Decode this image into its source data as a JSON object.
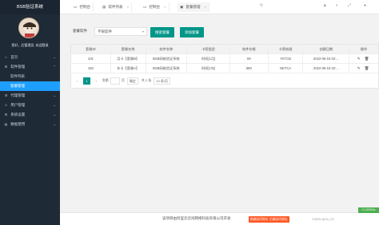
{
  "app": {
    "title": "BSB验证系统"
  },
  "user": {
    "greeting": "您好，后管理员, 欢迎登录"
  },
  "sidebar": {
    "items": [
      {
        "icon": "home-icon",
        "label": "首页",
        "arrow": "⌄"
      },
      {
        "icon": "software-icon",
        "label": "软件管理",
        "arrow": "⌃"
      },
      {
        "icon": "agent-icon",
        "label": "代理管理",
        "arrow": "⌄"
      },
      {
        "icon": "user-icon",
        "label": "用户管理",
        "arrow": "⌄"
      },
      {
        "icon": "settings-icon",
        "label": "系统设置",
        "arrow": "⌄"
      },
      {
        "icon": "report-icon",
        "label": "数据使用",
        "arrow": "⌄"
      }
    ],
    "subitems": [
      {
        "label": "软件列表"
      },
      {
        "label": "套餐管理"
      }
    ]
  },
  "header": {
    "home": "控制台",
    "tabs": [
      {
        "label": "控制台"
      },
      {
        "label": "软件列表"
      },
      {
        "label": "控制台"
      },
      {
        "label": "套餐管理"
      }
    ],
    "tabs_close": "×",
    "icons": [
      "refresh-icon",
      "lock-icon",
      "theme-icon",
      "fullscreen-icon",
      "user-icon"
    ]
  },
  "filter": {
    "label": "套餐软件",
    "select_value": "不限软件",
    "search_button": "搜索套餐",
    "add_button": "添加套餐"
  },
  "table": {
    "headers": [
      "套餐ID",
      "套餐名称",
      "软件名称",
      "卡密类型",
      "软件价格",
      "卡密前缀",
      "创建日期",
      "操作"
    ],
    "rows": [
      [
        "101",
        "月卡【套餐B】",
        "BSB网络验证系统",
        "时间[1月]",
        "69",
        "YKTCB",
        "2022-06-16 02:...",
        "✎ 🗑"
      ],
      [
        "150",
        "年卡【套餐A】",
        "BSB网络验证系统",
        "时间[1年]",
        "680",
        "NKTCA",
        "2022-06-16 02:...",
        "✎ 🗑"
      ]
    ]
  },
  "pager": {
    "current": "1",
    "goto_label": "到第",
    "page_unit": "页",
    "confirm": "确定",
    "total": "共 2 条",
    "size": "10 条/页"
  },
  "footer": {
    "text": "该项目由阿里云云闲网络科技有限公司开发",
    "badge1": "前端访问地址",
    "badge2": "后端访问地址"
  },
  "perf": "0.132300s",
  "watermark": "CSDN @Yu_5Y"
}
